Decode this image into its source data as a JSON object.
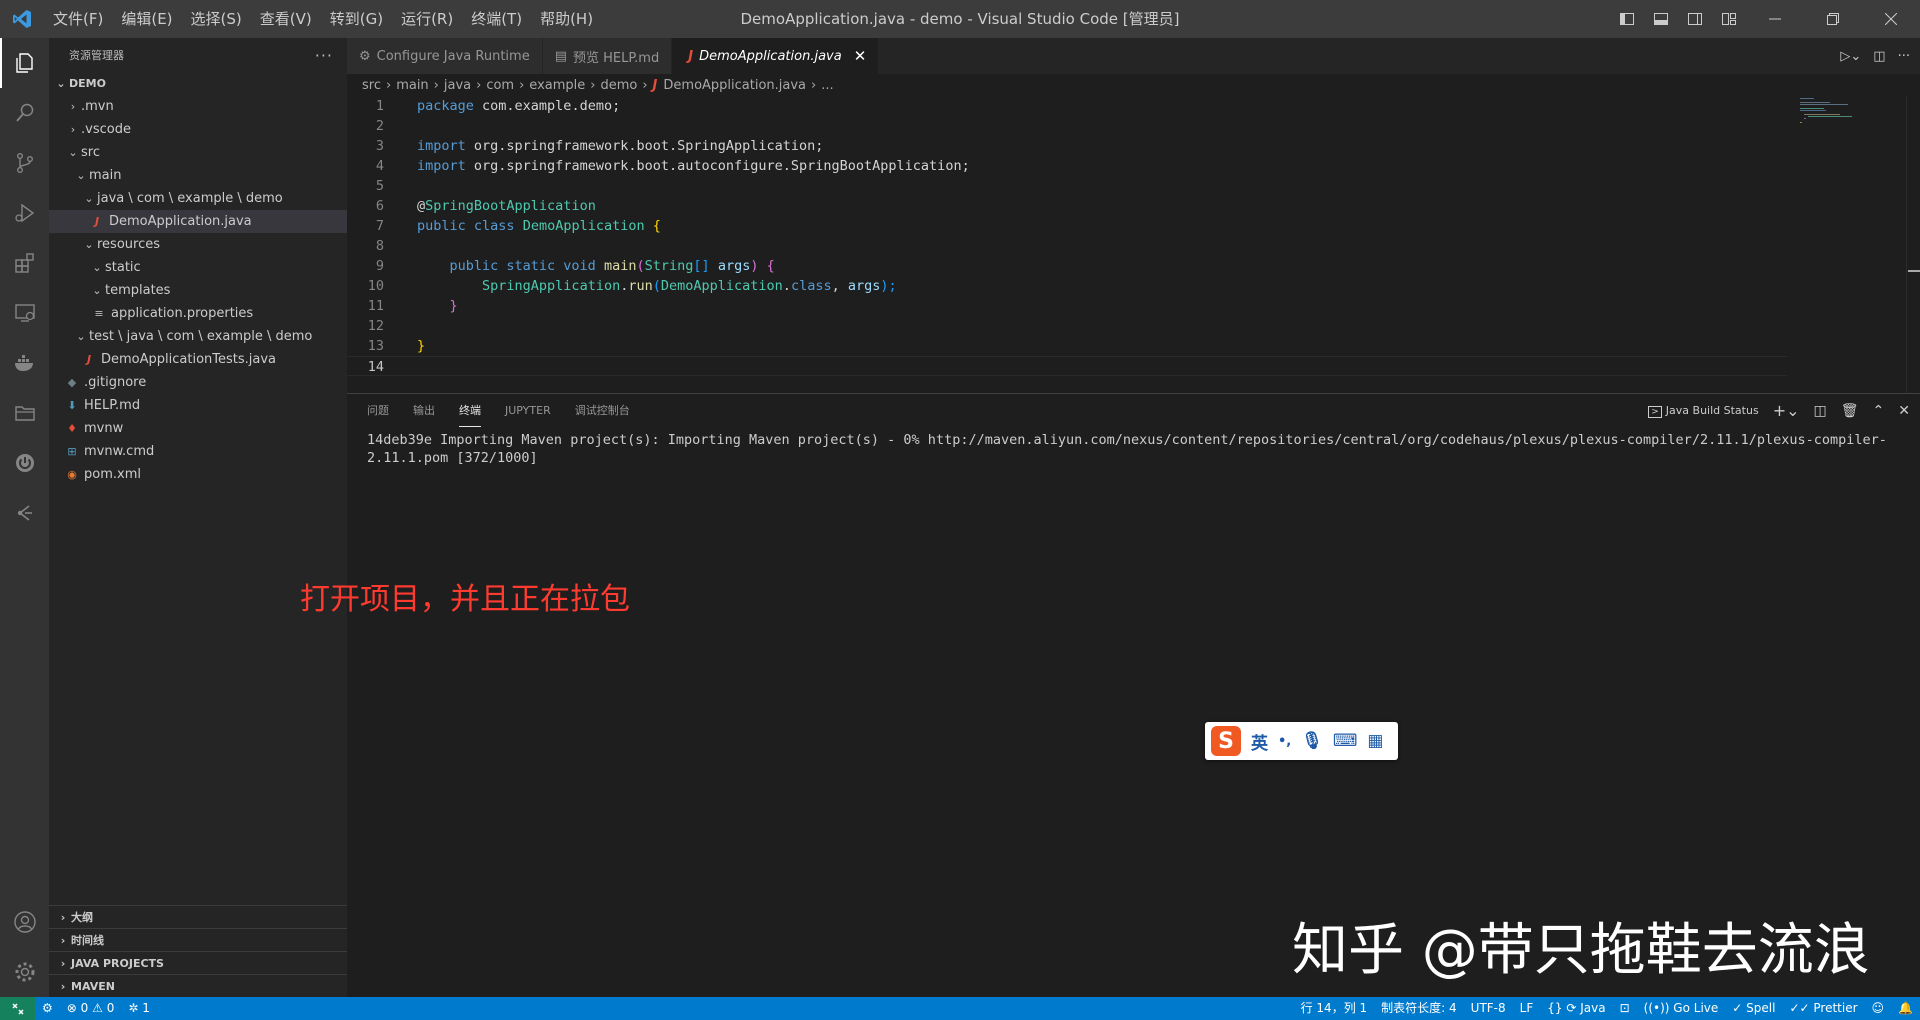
{
  "titlebar": {
    "menus": [
      "文件(F)",
      "编辑(E)",
      "选择(S)",
      "查看(V)",
      "转到(G)",
      "运行(R)",
      "终端(T)",
      "帮助(H)"
    ],
    "title": "DemoApplication.java - demo - Visual Studio Code [管理员]"
  },
  "sidebar": {
    "header": "资源管理器",
    "root": "DEMO",
    "tree": [
      {
        "label": ".mvn",
        "icon": "chevron-right",
        "depth": 0
      },
      {
        "label": ".vscode",
        "icon": "chevron-right",
        "depth": 0
      },
      {
        "label": "src",
        "icon": "chevron-down",
        "depth": 0
      },
      {
        "label": "main",
        "icon": "chevron-down",
        "depth": 1
      },
      {
        "label": "java \\ com \\ example \\ demo",
        "icon": "chevron-down",
        "depth": 2
      },
      {
        "label": "DemoApplication.java",
        "icon": "java-file",
        "depth": 3
      },
      {
        "label": "resources",
        "icon": "chevron-down",
        "depth": 2
      },
      {
        "label": "static",
        "icon": "chevron-down",
        "depth": 3
      },
      {
        "label": "templates",
        "icon": "chevron-down",
        "depth": 3
      },
      {
        "label": "application.properties",
        "icon": "properties-file",
        "depth": 3
      },
      {
        "label": "test \\ java \\ com \\ example \\ demo",
        "icon": "chevron-down",
        "depth": 1
      },
      {
        "label": "DemoApplicationTests.java",
        "icon": "java-file",
        "depth": 2
      },
      {
        "label": ".gitignore",
        "icon": "git-file",
        "depth": 0
      },
      {
        "label": "HELP.md",
        "icon": "markdown-file",
        "depth": 0
      },
      {
        "label": "mvnw",
        "icon": "maven-file",
        "depth": 0
      },
      {
        "label": "mvnw.cmd",
        "icon": "windows-file",
        "depth": 0
      },
      {
        "label": "pom.xml",
        "icon": "rss-file",
        "depth": 0
      }
    ],
    "sections": [
      "大纲",
      "时间线",
      "JAVA PROJECTS",
      "MAVEN"
    ]
  },
  "editor": {
    "tabs": [
      {
        "label": "Configure Java Runtime",
        "icon": "gear-icon"
      },
      {
        "label": "预览 HELP.md",
        "icon": "preview-icon"
      },
      {
        "label": "DemoApplication.java",
        "icon": "java-icon"
      }
    ],
    "breadcrumb": [
      "src",
      "main",
      "java",
      "com",
      "example",
      "demo",
      "DemoApplication.java",
      "..."
    ],
    "line_numbers": [
      "1",
      "2",
      "3",
      "4",
      "5",
      "6",
      "7",
      "8",
      "9",
      "10",
      "11",
      "12",
      "13",
      "14"
    ],
    "code": {
      "l1_kw": "package",
      "l1_rest": " com.example.demo;",
      "l3_kw": "import",
      "l3_rest": " org.springframework.boot.SpringApplication;",
      "l4_kw": "import",
      "l4_rest": " org.springframework.boot.autoconfigure.SpringBootApplication;",
      "l6_at": "@",
      "l6_ann": "SpringBootApplication",
      "l7_kw": "public class",
      "l7_cls": "DemoApplication",
      "l7_br": "{",
      "l9_kw": "public static void",
      "l9_fn": "main",
      "l9_p1": "(",
      "l9_type": "String",
      "l9_arr": "[]",
      "l9_arg": "args",
      "l9_p2": ")",
      "l9_br": "{",
      "l10_cls": "SpringApplication",
      "l10_dot": ".",
      "l10_fn": "run",
      "l10_p1": "(",
      "l10_cls2": "DemoApplication",
      "l10_dot2": ".",
      "l10_kw": "class",
      "l10_comma": ", ",
      "l10_arg": "args",
      "l10_p2": ");",
      "l11_br": "}",
      "l13_br": "}"
    }
  },
  "panel": {
    "tabs": [
      "问题",
      "输出",
      "终端",
      "JUPYTER",
      "调试控制台"
    ],
    "active_tab": "终端",
    "task_label": "Java Build Status",
    "terminal_text": "14deb39e Importing Maven project(s): Importing Maven project(s) - 0% http://maven.aliyun.com/nexus/content/repositories/central/org/codehaus/plexus/plexus-compiler/2.11.1/plexus-compiler-2.11.1.pom [372/1000]"
  },
  "annotation": "打开项目，并且正在拉包",
  "ime": {
    "logo": "S",
    "lang": "英",
    "punct": "•,"
  },
  "watermark": "知乎 @带只拖鞋去流浪",
  "statusbar": {
    "errors": "0",
    "warnings": "0",
    "ports": "1",
    "position": "行 14，列 1",
    "tab_size": "制表符长度: 4",
    "encoding": "UTF-8",
    "eol": "LF",
    "language": "Java",
    "go_live": "Go Live",
    "spell": "Spell",
    "prettier": "Prettier"
  },
  "colors": {
    "accent": "#007acc",
    "annotation": "#ff3b30",
    "remote": "#16825d"
  }
}
